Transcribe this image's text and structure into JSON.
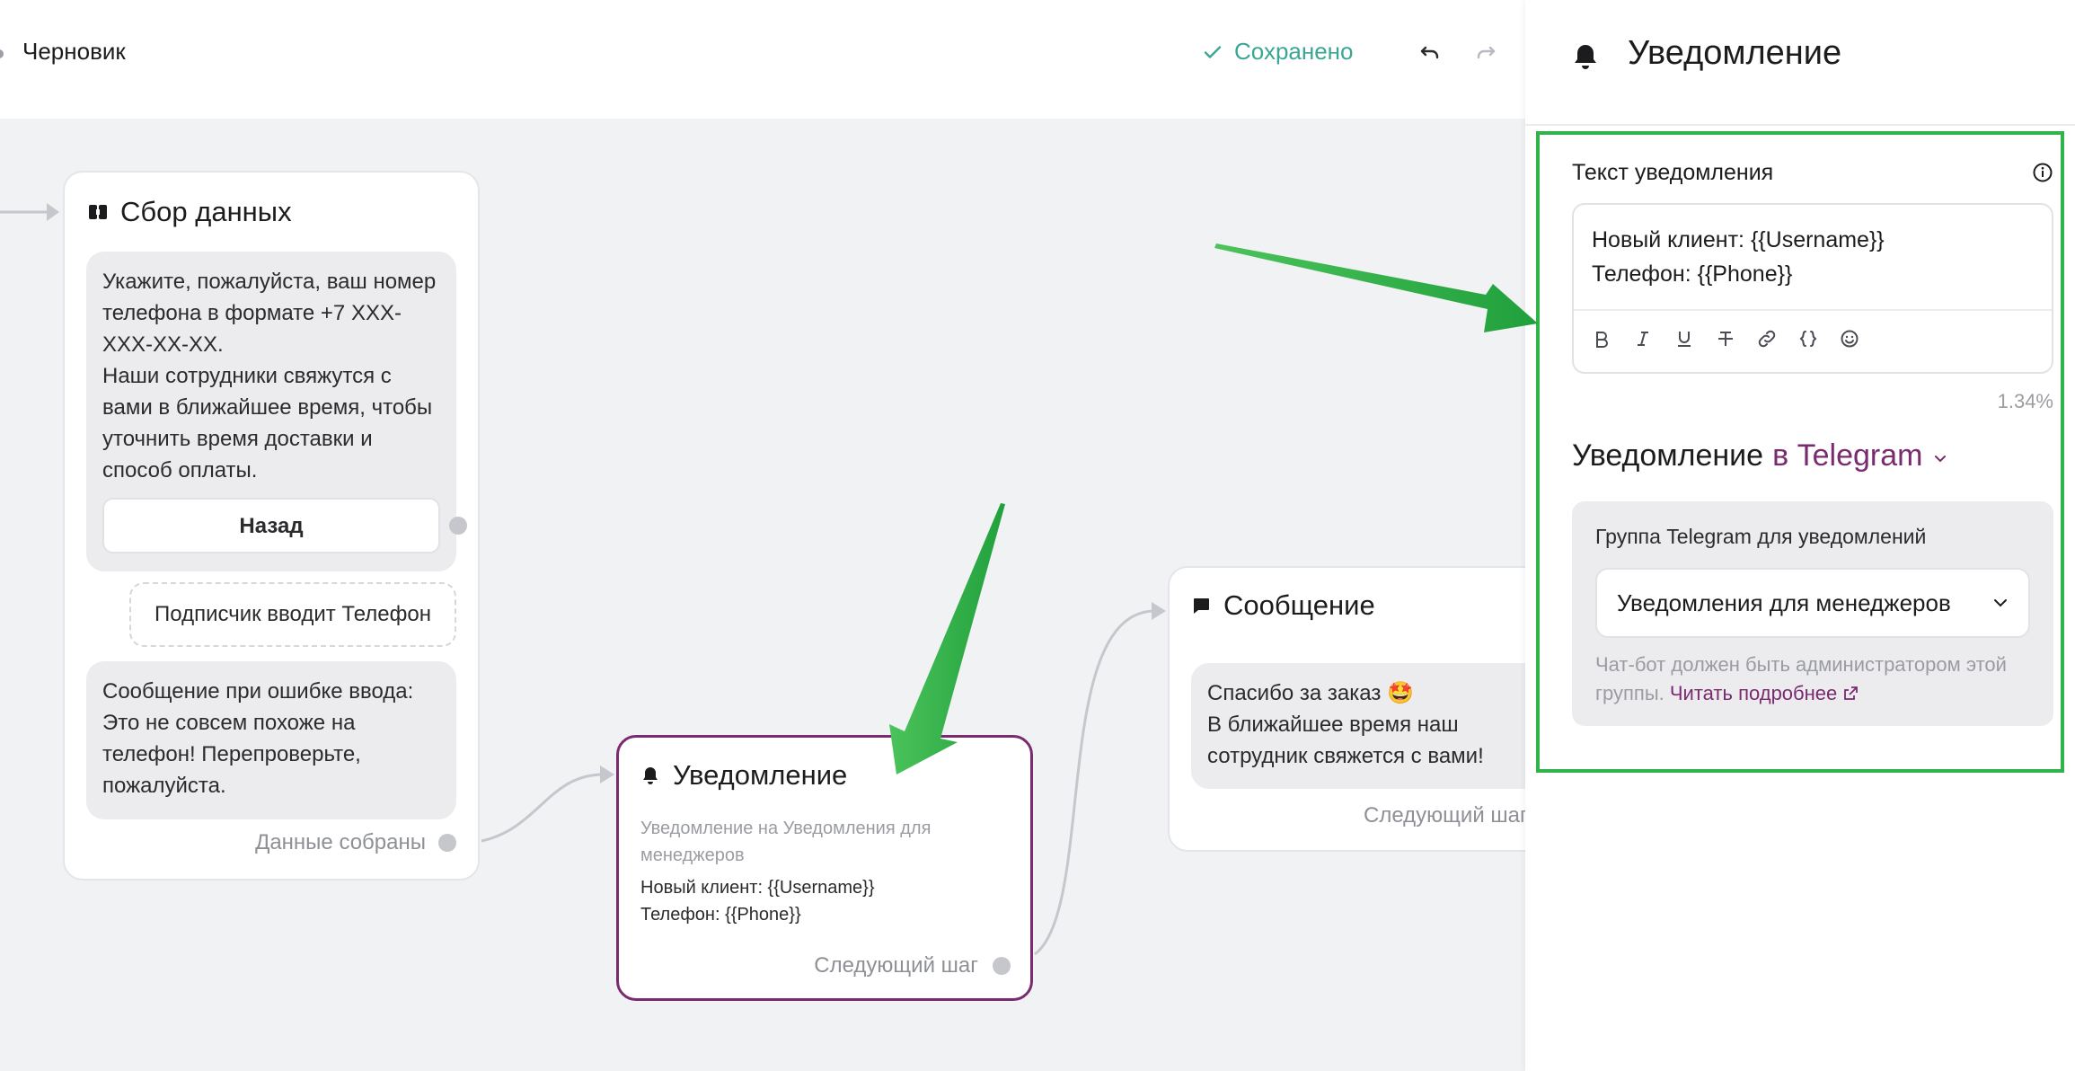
{
  "topbar": {
    "status": "Черновик",
    "saved": "Сохранено"
  },
  "nodes": {
    "collect": {
      "title": "Сбор данных",
      "question": "Укажите, пожалуйста, ваш номер телефона в формате +7 XXX-XXX-XX-XX.\nНаши сотрудники свяжутся с вами в ближайшее время, чтобы уточнить время доставки и способ оплаты.",
      "back_button": "Назад",
      "input_label": "Подписчик вводит Телефон",
      "error_text": "Сообщение при ошибке ввода:\nЭто не совсем похоже на телефон! Перепроверьте, пожалуйста.",
      "done_label": "Данные собраны"
    },
    "notify": {
      "title": "Уведомление",
      "subtitle": "Уведомление на Уведомления для менеджеров",
      "text": "Новый клиент: {{Username}}\nТелефон: {{Phone}}",
      "next_label": "Следующий шаг"
    },
    "message": {
      "title": "Сообщение",
      "text": "Спасибо за заказ 🤩\nВ ближайшее время наш сотрудник свяжется с вами!",
      "next_label": "Следующий шаг"
    }
  },
  "panel": {
    "title": "Уведомление",
    "field_label": "Текст уведомления",
    "editor_text": "Новый клиент: {{Username}}\nТелефон: {{Phone}}",
    "toolbar": [
      "bold",
      "italic",
      "underline",
      "strikethrough",
      "link",
      "variable",
      "emoji"
    ],
    "percent": "1.34%",
    "channel_prefix": "Уведомление",
    "channel_value": "в Telegram",
    "group_label": "Группа Telegram для уведомлений",
    "group_selected": "Уведомления для менеджеров",
    "note": "Чат-бот должен быть администратором этой группы.",
    "note_link": "Читать подробнее"
  },
  "colors": {
    "accent": "#7a2a6f",
    "saved": "#3aa693",
    "highlight": "#2fb34a"
  }
}
